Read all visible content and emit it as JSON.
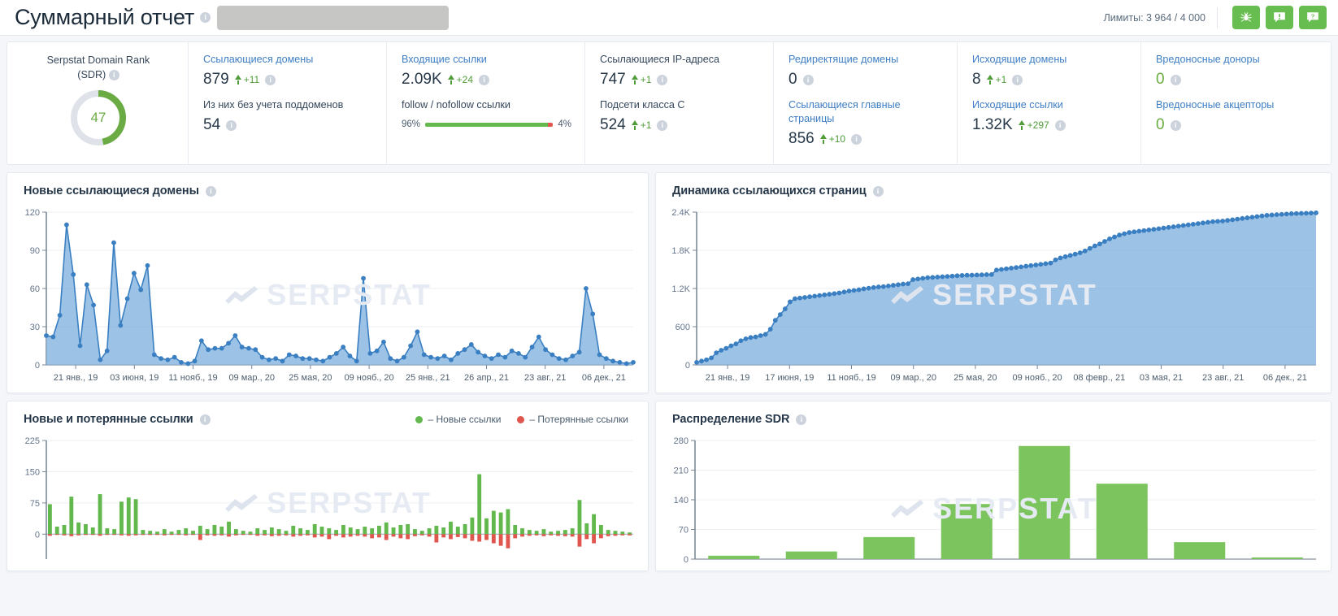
{
  "header": {
    "title": "Суммарный отчет",
    "redacted_field": "",
    "limits": "Лимиты: 3 964 / 4 000",
    "buttons": [
      {
        "name": "spider-icon",
        "label": "spider-icon"
      },
      {
        "name": "feedback-icon",
        "label": "!"
      },
      {
        "name": "help-icon",
        "label": "?"
      }
    ]
  },
  "kpi": {
    "sdr": {
      "label_line1": "Serpstat Domain Rank",
      "label_line2": "(SDR)",
      "value": 47,
      "max": 100,
      "arc_color": "#6aab44",
      "track_color": "#dfe3e9"
    },
    "ref_domains": {
      "label": "Ссылающиеся домены",
      "value": "879",
      "delta": "+11",
      "sub_label": "Из них без учета поддоменов",
      "sub_value": "54"
    },
    "backlinks": {
      "label": "Входящие ссылки",
      "value": "2.09K",
      "delta": "+24",
      "sub_label_a": "follow",
      "sub_label_sep": " / ",
      "sub_label_b": "nofollow",
      "sub_label_c": " ссылки",
      "follow_pct": "96%",
      "nofollow_pct": "4%",
      "follow_value": 96,
      "nofollow_value": 4
    },
    "ref_ips": {
      "label": "Ссылающиеся IP-адреса",
      "value": "747",
      "delta": "+1",
      "sub_label": "Подсети класса C",
      "sub_value": "524",
      "sub_delta": "+1"
    },
    "redirect_domains": {
      "label": "Редиректящие домены",
      "value": "0",
      "sub_label_l1": "Ссылающиеся главные",
      "sub_label_l2": "страницы",
      "sub_value": "856",
      "sub_delta": "+10"
    },
    "out_domains": {
      "label": "Исходящие домены",
      "value": "8",
      "delta": "+1",
      "sub_label": "Исходящие ссылки",
      "sub_value": "1.32K",
      "sub_delta": "+297"
    },
    "malicious": {
      "label": "Вредоносные доноры",
      "value": "0",
      "sub_label": "Вредоносные акцепторы",
      "sub_value": "0"
    }
  },
  "cards": {
    "new_ref_domains": {
      "title": "Новые ссылающиеся домены"
    },
    "ref_pages_dynamics": {
      "title": "Динамика ссылающихся страниц"
    },
    "new_lost_links": {
      "title": "Новые и потерянные ссылки",
      "legend_new": "– Новые ссылки",
      "legend_lost": "– Потерянные ссылки"
    },
    "sdr_distribution": {
      "title": "Распределение SDR"
    }
  },
  "watermark": "SERPSTAT",
  "chart_data": [
    {
      "id": "new_ref_domains",
      "type": "area",
      "title": "Новые ссылающиеся домены",
      "ylabel": "",
      "xlabel": "",
      "ylim": [
        0,
        120
      ],
      "yticks": [
        0,
        30,
        60,
        90,
        120
      ],
      "grid": true,
      "legend": "none",
      "color": "#3a7fc1",
      "fill": "#86b4e0",
      "xticks": [
        "21 янв., 19",
        "03 июня, 19",
        "11 нояб., 19",
        "09 мар., 20",
        "25 мая, 20",
        "09 нояб., 20",
        "25 янв., 21",
        "26 апр., 21",
        "23 авг., 21",
        "06 дек., 21"
      ],
      "values": [
        23,
        22,
        39,
        110,
        71,
        15,
        63,
        47,
        4,
        11,
        96,
        31,
        52,
        72,
        59,
        78,
        8,
        5,
        4,
        6,
        2,
        1,
        3,
        19,
        12,
        13,
        13,
        17,
        23,
        14,
        13,
        12,
        6,
        4,
        5,
        3,
        8,
        7,
        5,
        5,
        4,
        3,
        6,
        9,
        14,
        7,
        3,
        68,
        9,
        11,
        18,
        5,
        3,
        6,
        15,
        26,
        8,
        6,
        5,
        7,
        4,
        9,
        12,
        16,
        10,
        7,
        5,
        8,
        6,
        11,
        9,
        6,
        14,
        22,
        12,
        8,
        5,
        4,
        7,
        10,
        60,
        40,
        8,
        5,
        3,
        2,
        1,
        2
      ]
    },
    {
      "id": "ref_pages_dynamics",
      "type": "area",
      "title": "Динамика ссылающихся страниц",
      "ylim": [
        0,
        2400
      ],
      "yticks": [
        0,
        600,
        1200,
        1800,
        2400
      ],
      "ytick_labels": [
        "0",
        "600",
        "1.2K",
        "1.8K",
        "2.4K"
      ],
      "grid": true,
      "color": "#3a7fc1",
      "fill": "#86b4e0",
      "xticks": [
        "21 янв., 19",
        "17 июня, 19",
        "11 нояб., 19",
        "09 мар., 20",
        "25 мая, 20",
        "09 нояб., 20",
        "08 февр., 21",
        "03 мая, 21",
        "23 авг., 21",
        "06 дек., 21"
      ],
      "values": [
        40,
        60,
        80,
        110,
        190,
        230,
        260,
        300,
        330,
        380,
        410,
        430,
        440,
        460,
        480,
        560,
        700,
        790,
        880,
        990,
        1040,
        1050,
        1060,
        1070,
        1080,
        1090,
        1100,
        1110,
        1120,
        1130,
        1145,
        1160,
        1170,
        1180,
        1195,
        1205,
        1215,
        1225,
        1230,
        1240,
        1250,
        1260,
        1270,
        1275,
        1340,
        1350,
        1360,
        1370,
        1375,
        1380,
        1385,
        1390,
        1395,
        1400,
        1405,
        1408,
        1410,
        1412,
        1415,
        1418,
        1420,
        1490,
        1500,
        1510,
        1520,
        1530,
        1540,
        1550,
        1560,
        1570,
        1580,
        1590,
        1600,
        1650,
        1680,
        1700,
        1720,
        1740,
        1760,
        1790,
        1830,
        1870,
        1900,
        1940,
        1980,
        2010,
        2040,
        2060,
        2080,
        2090,
        2100,
        2110,
        2120,
        2130,
        2140,
        2150,
        2160,
        2170,
        2180,
        2190,
        2200,
        2210,
        2220,
        2230,
        2240,
        2250,
        2255,
        2260,
        2270,
        2280,
        2290,
        2300,
        2310,
        2320,
        2330,
        2340,
        2350,
        2355,
        2360,
        2365,
        2370,
        2375,
        2378,
        2380,
        2382,
        2385,
        2388
      ]
    },
    {
      "id": "new_lost_links",
      "type": "bar",
      "title": "Новые и потерянные ссылки",
      "ylim": [
        -60,
        225
      ],
      "yticks": [
        0,
        75,
        150,
        225
      ],
      "grid": true,
      "series": [
        {
          "name": "– Новые ссылки",
          "color": "#62b84d",
          "values": [
            72,
            18,
            22,
            90,
            28,
            24,
            16,
            96,
            14,
            12,
            78,
            88,
            84,
            10,
            8,
            6,
            12,
            6,
            10,
            14,
            8,
            20,
            12,
            22,
            18,
            30,
            12,
            8,
            6,
            14,
            10,
            16,
            12,
            8,
            20,
            14,
            10,
            24,
            18,
            14,
            10,
            22,
            16,
            12,
            18,
            14,
            20,
            28,
            16,
            22,
            24,
            12,
            8,
            14,
            20,
            16,
            30,
            18,
            24,
            40,
            144,
            38,
            56,
            52,
            60,
            22,
            14,
            10,
            8,
            12,
            6,
            8,
            10,
            14,
            82,
            26,
            48,
            22,
            10,
            8,
            6,
            4
          ]
        },
        {
          "name": "– Потерянные ссылки",
          "color": "#e0564f",
          "values": [
            -4,
            -2,
            -3,
            -5,
            -3,
            -2,
            -2,
            -4,
            -2,
            -2,
            -3,
            -4,
            -3,
            -2,
            -2,
            -2,
            -3,
            -2,
            -2,
            -3,
            -2,
            -14,
            -3,
            -4,
            -3,
            -6,
            -3,
            -2,
            -2,
            -4,
            -3,
            -5,
            -4,
            -3,
            -6,
            -4,
            -3,
            -8,
            -6,
            -12,
            -4,
            -8,
            -6,
            -4,
            -6,
            -10,
            -8,
            -14,
            -6,
            -10,
            -12,
            -5,
            -3,
            -6,
            -20,
            -8,
            -12,
            -7,
            -10,
            -16,
            -18,
            -14,
            -22,
            -28,
            -34,
            -10,
            -6,
            -4,
            -3,
            -5,
            -3,
            -4,
            -5,
            -6,
            -30,
            -12,
            -22,
            -10,
            -5,
            -4,
            -3,
            -3
          ]
        }
      ]
    },
    {
      "id": "sdr_distribution",
      "type": "bar",
      "title": "Распределение SDR",
      "ylim": [
        0,
        280
      ],
      "yticks": [
        0,
        70,
        140,
        210,
        280
      ],
      "grid": true,
      "color": "#7cc45e",
      "categories": [
        "",
        "",
        "",
        "",
        "",
        "",
        "",
        ""
      ],
      "values": [
        8,
        18,
        52,
        130,
        267,
        178,
        40,
        4
      ]
    }
  ]
}
